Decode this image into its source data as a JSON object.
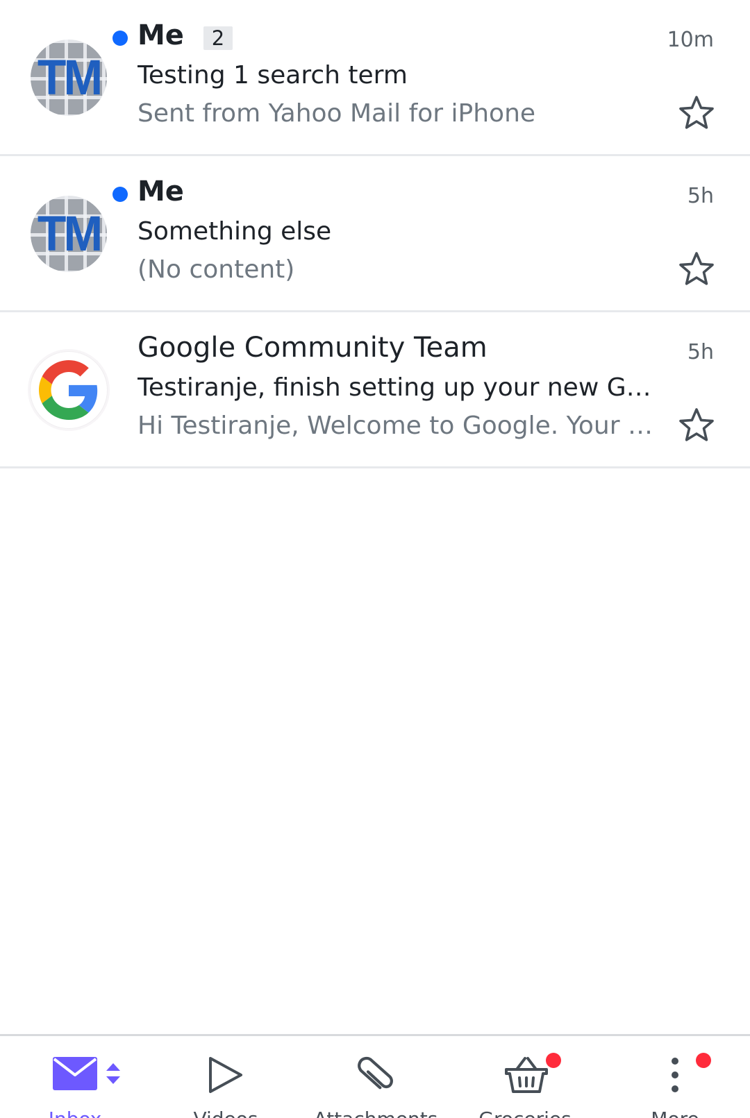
{
  "messages": [
    {
      "sender": "Me",
      "unread": true,
      "thread_count": "2",
      "time": "10m",
      "subject": "Testing 1 search term",
      "snippet": "Sent from Yahoo Mail for iPhone",
      "avatar": {
        "type": "photo",
        "initials": "TM"
      },
      "starred": false
    },
    {
      "sender": "Me",
      "unread": true,
      "time": "5h",
      "subject": "Something else",
      "snippet": "(No content)",
      "avatar": {
        "type": "photo",
        "initials": "TM"
      },
      "starred": false
    },
    {
      "sender": "Google Community Team",
      "unread": false,
      "time": "5h",
      "subject": "Testiranje, finish setting up your new Google Account",
      "snippet": "Hi Testiranje, Welcome to Google. Your new account comes with access",
      "avatar": {
        "type": "logo",
        "icon": "google-logo-icon"
      },
      "starred": false
    }
  ],
  "bottom_nav": {
    "items": [
      {
        "label": "Inbox",
        "icon": "mail-envelope-icon",
        "active": true,
        "has_sort_toggle": true,
        "badge": false
      },
      {
        "label": "Videos",
        "icon": "play-icon",
        "active": false,
        "badge": false
      },
      {
        "label": "Attachments",
        "icon": "paperclip-icon",
        "active": false,
        "badge": false
      },
      {
        "label": "Groceries",
        "icon": "basket-icon",
        "active": false,
        "badge": true
      },
      {
        "label": "More",
        "icon": "more-vertical-icon",
        "active": false,
        "badge": true
      }
    ]
  },
  "colors": {
    "accent": "#6d59ff",
    "unread_dot": "#0f69ff",
    "notification_dot": "#ff2b3b",
    "text_primary": "#1d2228",
    "text_secondary": "#6e7780"
  }
}
